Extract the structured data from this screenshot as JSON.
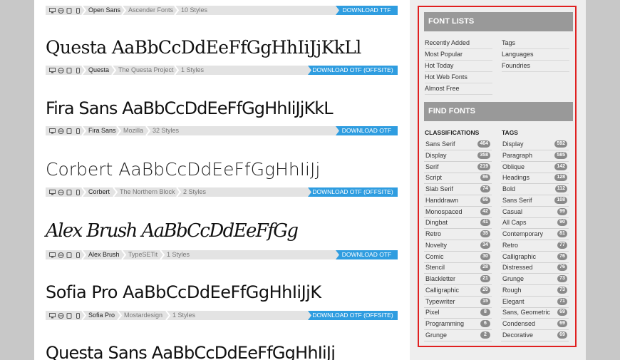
{
  "entries": [
    {
      "sample": "",
      "name": "Open Sans",
      "foundry": "Ascender Fonts",
      "styles": "10 Styles",
      "download": "DOWNLOAD TTF"
    },
    {
      "sample": "Questa AaBbCcDdEeFfGgHhIiJjKkLl",
      "name": "Questa",
      "foundry": "The Questa Project",
      "styles": "1 Styles",
      "download": "DOWNLOAD OTF (OFFSITE)"
    },
    {
      "sample": "Fira Sans AaBbCcDdEeFfGgHhIiJjKkL",
      "name": "Fira Sans",
      "foundry": "Mozilla",
      "styles": "32 Styles",
      "download": "DOWNLOAD OTF"
    },
    {
      "sample": "Corbert AaBbCcDdEeFfGgHhIiJj",
      "name": "Corbert",
      "foundry": "The Northern Block",
      "styles": "2 Styles",
      "download": "DOWNLOAD OTF (OFFSITE)"
    },
    {
      "sample": "Alex Brush AaBbCcDdEeFfGg",
      "name": "Alex Brush",
      "foundry": "TypeSETit",
      "styles": "1 Styles",
      "download": "DOWNLOAD OTF"
    },
    {
      "sample": "Sofia Pro AaBbCcDdEeFfGgHhIiJjK",
      "name": "Sofia Pro",
      "foundry": "Mostardesign",
      "styles": "1 Styles",
      "download": "DOWNLOAD OTF (OFFSITE)"
    },
    {
      "sample": "Questa Sans AaBbCcDdEeFfGgHhIiJj",
      "name": "",
      "foundry": "",
      "styles": "",
      "download": ""
    }
  ],
  "font_lists": {
    "title": "FONT LISTS",
    "col1": [
      "Recently Added",
      "Most Popular",
      "Hot Today",
      "Hot Web Fonts",
      "Almost Free"
    ],
    "col2": [
      "Tags",
      "Languages",
      "Foundries"
    ]
  },
  "find_fonts": {
    "title": "FIND FONTS",
    "classifications_title": "CLASSIFICATIONS",
    "tags_title": "TAGS",
    "classifications": [
      {
        "label": "Sans Serif",
        "count": "464"
      },
      {
        "label": "Display",
        "count": "358"
      },
      {
        "label": "Serif",
        "count": "219"
      },
      {
        "label": "Script",
        "count": "86"
      },
      {
        "label": "Slab Serif",
        "count": "74"
      },
      {
        "label": "Handdrawn",
        "count": "66"
      },
      {
        "label": "Monospaced",
        "count": "42"
      },
      {
        "label": "Dingbat",
        "count": "41"
      },
      {
        "label": "Retro",
        "count": "35"
      },
      {
        "label": "Novelty",
        "count": "34"
      },
      {
        "label": "Comic",
        "count": "30"
      },
      {
        "label": "Stencil",
        "count": "28"
      },
      {
        "label": "Blackletter",
        "count": "21"
      },
      {
        "label": "Calligraphic",
        "count": "20"
      },
      {
        "label": "Typewriter",
        "count": "15"
      },
      {
        "label": "Pixel",
        "count": "8"
      },
      {
        "label": "Programming",
        "count": "6"
      },
      {
        "label": "Grunge",
        "count": "2"
      }
    ],
    "tags": [
      {
        "label": "Display",
        "count": "592"
      },
      {
        "label": "Paragraph",
        "count": "585"
      },
      {
        "label": "Oblique",
        "count": "142"
      },
      {
        "label": "Headings",
        "count": "128"
      },
      {
        "label": "Bold",
        "count": "112"
      },
      {
        "label": "Sans Serif",
        "count": "108"
      },
      {
        "label": "Casual",
        "count": "99"
      },
      {
        "label": "All Caps",
        "count": "90"
      },
      {
        "label": "Contemporary",
        "count": "81"
      },
      {
        "label": "Retro",
        "count": "77"
      },
      {
        "label": "Calligraphic",
        "count": "76"
      },
      {
        "label": "Distressed",
        "count": "76"
      },
      {
        "label": "Grunge",
        "count": "73"
      },
      {
        "label": "Rough",
        "count": "73"
      },
      {
        "label": "Elegant",
        "count": "71"
      },
      {
        "label": "Sans, Geometric",
        "count": "69"
      },
      {
        "label": "Condensed",
        "count": "69"
      },
      {
        "label": "Decorative",
        "count": "69"
      }
    ]
  },
  "icons": [
    "desktop-icon",
    "web-icon",
    "tablet-icon",
    "mobile-icon"
  ],
  "colors": {
    "download": "#2f9de0",
    "highlight_border": "#e02020",
    "section_header": "#999999"
  }
}
